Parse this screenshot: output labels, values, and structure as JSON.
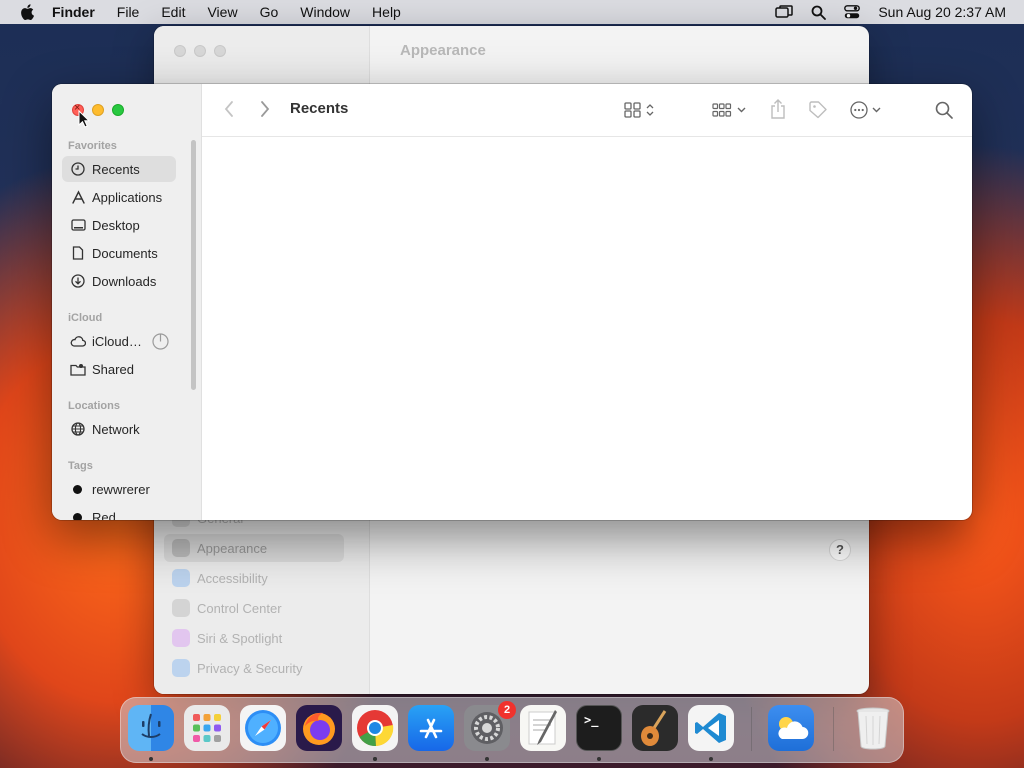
{
  "menubar": {
    "app_name": "Finder",
    "items": [
      "File",
      "Edit",
      "View",
      "Go",
      "Window",
      "Help"
    ],
    "datetime": "Sun Aug 20  2:37 AM"
  },
  "bg_window": {
    "title": "Appearance",
    "sidebar": [
      {
        "label": "General",
        "icon": "gear-icon"
      },
      {
        "label": "Appearance",
        "icon": "appearance-icon",
        "selected": true
      },
      {
        "label": "Accessibility",
        "icon": "accessibility-icon"
      },
      {
        "label": "Control Center",
        "icon": "control-center-icon"
      },
      {
        "label": "Siri & Spotlight",
        "icon": "siri-icon"
      },
      {
        "label": "Privacy & Security",
        "icon": "hand-icon"
      }
    ],
    "help_label": "?"
  },
  "finder": {
    "title": "Recents",
    "sections": {
      "favorites": "Favorites",
      "icloud": "iCloud",
      "locations": "Locations",
      "tags": "Tags"
    },
    "favorites": [
      {
        "label": "Recents",
        "icon": "clock-icon",
        "selected": true
      },
      {
        "label": "Applications",
        "icon": "applications-icon"
      },
      {
        "label": "Desktop",
        "icon": "desktop-icon"
      },
      {
        "label": "Documents",
        "icon": "document-icon"
      },
      {
        "label": "Downloads",
        "icon": "download-icon"
      }
    ],
    "icloud": [
      {
        "label": "iCloud…",
        "icon": "cloud-icon"
      },
      {
        "label": "Shared",
        "icon": "shared-folder-icon"
      }
    ],
    "locations": [
      {
        "label": "Network",
        "icon": "globe-icon"
      }
    ],
    "tags": [
      {
        "label": "rewwrerer",
        "color": "#111111"
      },
      {
        "label": "Red",
        "color": "#111111"
      }
    ]
  },
  "dock": {
    "apps": [
      "Finder",
      "Launchpad",
      "Safari",
      "Firefox",
      "Chrome",
      "App Store",
      "System Settings",
      "TextEdit",
      "Terminal",
      "GarageBand",
      "Visual Studio Code",
      "Weather",
      "Trash"
    ],
    "settings_badge": "2",
    "terminal_prompt": ">_"
  }
}
